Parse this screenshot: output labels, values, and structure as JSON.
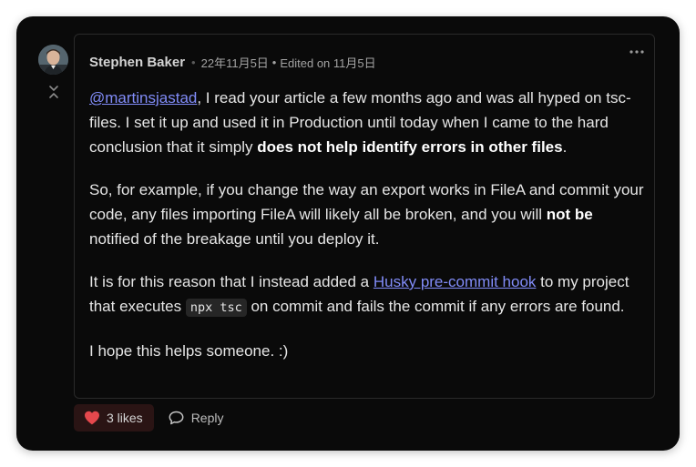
{
  "comment": {
    "author": "Stephen Baker",
    "date": "22年11月5日",
    "edited": "Edited on 11月5日",
    "paragraphs": {
      "p1": {
        "mention": "@martinsjastad",
        "t1": ", I read your article a few months ago and was all hyped on tsc-files. I set it up and used it in Production until today when I came to the hard conclusion that it simply ",
        "b1": "does not help identify errors in other files",
        "t2": "."
      },
      "p2": {
        "t1": "So, for example, if you change the way an export works in FileA and commit your code, any files importing FileA will likely all be broken, and you will ",
        "b1": "not be",
        "t2": " notified of the breakage until you deploy it."
      },
      "p3": {
        "t1": "It is for this reason that I instead added a ",
        "link": "Husky pre-commit hook",
        "t2": " to my project that executes ",
        "code": "npx tsc",
        "t3": " on commit and fails the commit if any errors are found."
      },
      "p4": {
        "t1": "I hope this helps someone. :)"
      }
    }
  },
  "actions": {
    "likes_label": "3 likes",
    "reply_label": "Reply"
  },
  "icons": {
    "avatar": "avatar",
    "collapse": "collapse-icon",
    "more": "more-horizontal-icon",
    "like": "heart-icon",
    "reply": "speech-bubble-icon"
  },
  "colors": {
    "background": "#0a0a0a",
    "link": "#818cf8",
    "heart": "#e5484d",
    "like_bg": "#2a1414"
  }
}
